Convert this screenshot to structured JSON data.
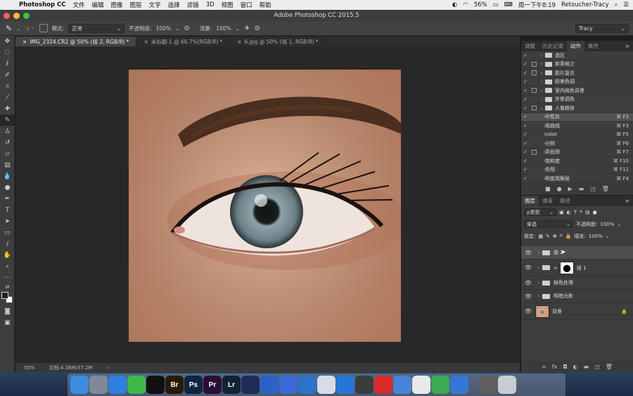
{
  "menubar": {
    "app": "Photoshop CC",
    "items": [
      "文件",
      "编辑",
      "图像",
      "图层",
      "文字",
      "选择",
      "滤镜",
      "3D",
      "视图",
      "窗口",
      "帮助"
    ],
    "battery": "56%",
    "clock": "周一下午8:19",
    "user": "Retoucher-Tracy"
  },
  "window": {
    "title": "Adobe Photoshop CC 2015.5"
  },
  "options": {
    "mode_label": "模式:",
    "mode_value": "正常",
    "opacity_label": "不透明度:",
    "opacity_value": "100%",
    "flow_label": "流量:",
    "flow_value": "100%",
    "workspace": "Tracy"
  },
  "tabs": [
    {
      "label": "IMG_2324.CR2 @ 50% (组 2, RGB/8) *"
    },
    {
      "label": "未标题-1 @ 66.7%(RGB/8) *"
    },
    {
      "label": "6.jpg @ 50% (组 1, RGB/8) *"
    }
  ],
  "status": {
    "zoom": "50%",
    "doc": "文档:4.38M/37.2M"
  },
  "actions_panel": {
    "tabs": [
      "调整",
      "历史记录",
      "动作",
      "属性"
    ],
    "active_tab": "动作",
    "rows": [
      {
        "label": "选区",
        "key": "",
        "type": "set",
        "box": false
      },
      {
        "label": "新英格兰",
        "key": "",
        "type": "set",
        "box": true
      },
      {
        "label": "胶片复古",
        "key": "",
        "type": "set",
        "box": true
      },
      {
        "label": "欧美色调",
        "key": "",
        "type": "set",
        "box": false
      },
      {
        "label": "室内纯色背景",
        "key": "",
        "type": "set",
        "box": true
      },
      {
        "label": "外景调色",
        "key": "",
        "type": "set",
        "box": false
      },
      {
        "label": "人像精修",
        "key": "",
        "type": "set-open",
        "box": true
      },
      {
        "label": "中性灰",
        "key": "⌘ F2",
        "type": "action",
        "box": false
      },
      {
        "label": "观曲线",
        "key": "⌘ F3",
        "type": "action",
        "box": false
      },
      {
        "label": "color",
        "key": "⌘ F5",
        "type": "action",
        "box": false
      },
      {
        "label": "分频",
        "key": "⌘ F6",
        "type": "action",
        "box": false
      },
      {
        "label": "高低频",
        "key": "⌘ F7",
        "type": "action",
        "box": true
      },
      {
        "label": "饱和度",
        "key": "⌘ F10",
        "type": "action",
        "box": false
      },
      {
        "label": "色相",
        "key": "⌘ F11",
        "type": "action",
        "box": false
      },
      {
        "label": "明度观察层",
        "key": "⌘ F4",
        "type": "action",
        "box": false
      }
    ]
  },
  "layers_panel": {
    "tabs": [
      "图层",
      "通道",
      "路径"
    ],
    "active_tab": "图层",
    "filter_kind": "ρ类型",
    "blend_mode": "穿透",
    "opacity_label": "不透明度:",
    "opacity_value": "100%",
    "lock_label": "锁定:",
    "fill_label": "填充:",
    "fill_value": "100%",
    "layers": [
      {
        "name": "组 2",
        "kind": "group",
        "selected": true
      },
      {
        "name": "组 1",
        "kind": "group-mask",
        "selected": false
      },
      {
        "name": "掉色处理",
        "kind": "group",
        "selected": false
      },
      {
        "name": "明暗光影",
        "kind": "group",
        "selected": false
      },
      {
        "name": "背景",
        "kind": "background",
        "selected": false
      }
    ]
  },
  "colors": {
    "accent": "#2d6dd8",
    "photo_skin": "#e1b194",
    "iris": "#7d929a"
  },
  "dock": [
    {
      "name": "finder-icon",
      "label": "",
      "color": "#3b8de0"
    },
    {
      "name": "launchpad-icon",
      "label": "",
      "color": "#7e8a99"
    },
    {
      "name": "safari-icon",
      "label": "",
      "color": "#2e7fe0"
    },
    {
      "name": "wechat-icon",
      "label": "",
      "color": "#3fb94a"
    },
    {
      "name": "qq-icon",
      "label": "",
      "color": "#111111"
    },
    {
      "name": "bridge-icon",
      "label": "Br",
      "color": "#2a1a06"
    },
    {
      "name": "photoshop-icon",
      "label": "Ps",
      "color": "#0c2540"
    },
    {
      "name": "premiere-icon",
      "label": "Pr",
      "color": "#2a0f35"
    },
    {
      "name": "lightroom-icon",
      "label": "Lr",
      "color": "#112436"
    },
    {
      "name": "cinema4d-icon",
      "label": "",
      "color": "#1c2b5a"
    },
    {
      "name": "baidu-icon",
      "label": "",
      "color": "#2c62c8"
    },
    {
      "name": "photo-booth-icon",
      "label": "",
      "color": "#3a69d8"
    },
    {
      "name": "1password-icon",
      "label": "",
      "color": "#2c73c9"
    },
    {
      "name": "cluster-icon",
      "label": "",
      "color": "#d8dce8"
    },
    {
      "name": "player-icon",
      "label": "",
      "color": "#2476d8"
    },
    {
      "name": "aperture-icon",
      "label": "",
      "color": "#3c3c3c"
    },
    {
      "name": "netease-music-icon",
      "label": "",
      "color": "#d82a2a"
    },
    {
      "name": "quicktime-icon",
      "label": "",
      "color": "#4b83d6"
    },
    {
      "name": "textedit-icon",
      "label": "",
      "color": "#e9e9e9"
    },
    {
      "name": "numbers-icon",
      "label": "",
      "color": "#3caa50"
    },
    {
      "name": "keynote-icon",
      "label": "",
      "color": "#3477d8"
    },
    {
      "name": "screenshot-icon",
      "label": "",
      "color": "#5e5e5e"
    },
    {
      "name": "trash-icon",
      "label": "",
      "color": "#c9ccd2"
    }
  ]
}
